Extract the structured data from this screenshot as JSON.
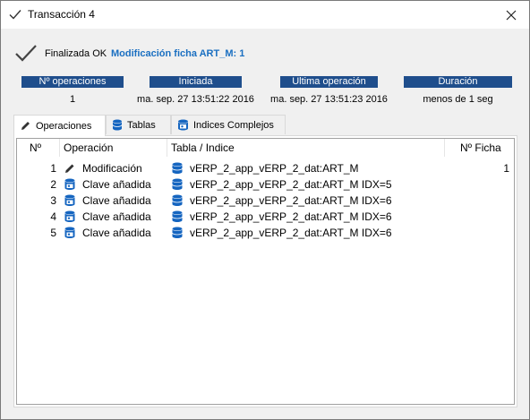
{
  "window": {
    "title": "Transacción 4",
    "title_icon": "check-icon",
    "close_icon": "close-icon"
  },
  "status": {
    "icon": "check-icon",
    "text": "Finalizada OK",
    "detail": "Modificación ficha ART_M: 1"
  },
  "info": {
    "headers": [
      "Nº operaciones",
      "Iniciada",
      "Ultima operación",
      "Duración"
    ],
    "values": [
      "1",
      "ma. sep. 27 13:51:22 2016",
      "ma. sep. 27 13:51:23 2016",
      "menos de 1 seg"
    ]
  },
  "tabs": [
    {
      "label": "Operaciones",
      "icon": "pencil-icon",
      "active": true
    },
    {
      "label": "Tablas",
      "icon": "database-icon",
      "active": false
    },
    {
      "label": "Indices Complejos",
      "icon": "key-database-icon",
      "active": false
    }
  ],
  "table": {
    "columns": [
      "Nº",
      "Operación",
      "Tabla / Indice",
      "Nº Ficha"
    ],
    "rows": [
      {
        "n": "1",
        "op_icon": "pencil-icon",
        "op": "Modificación",
        "table_icon": "database-icon",
        "table": "vERP_2_app_vERP_2_dat:ART_M",
        "ficha": "1"
      },
      {
        "n": "2",
        "op_icon": "key-database-icon",
        "op": "Clave añadida",
        "table_icon": "database-icon",
        "table": "vERP_2_app_vERP_2_dat:ART_M IDX=5",
        "ficha": ""
      },
      {
        "n": "3",
        "op_icon": "key-database-icon",
        "op": "Clave añadida",
        "table_icon": "database-icon",
        "table": "vERP_2_app_vERP_2_dat:ART_M IDX=6",
        "ficha": ""
      },
      {
        "n": "4",
        "op_icon": "key-database-icon",
        "op": "Clave añadida",
        "table_icon": "database-icon",
        "table": "vERP_2_app_vERP_2_dat:ART_M IDX=6",
        "ficha": ""
      },
      {
        "n": "5",
        "op_icon": "key-database-icon",
        "op": "Clave añadida",
        "table_icon": "database-icon",
        "table": "vERP_2_app_vERP_2_dat:ART_M IDX=6",
        "ficha": ""
      }
    ]
  },
  "colors": {
    "header_bg": "#1f4e8c",
    "detail_text": "#1a6fc1",
    "icon_blue": "#1565c0"
  }
}
